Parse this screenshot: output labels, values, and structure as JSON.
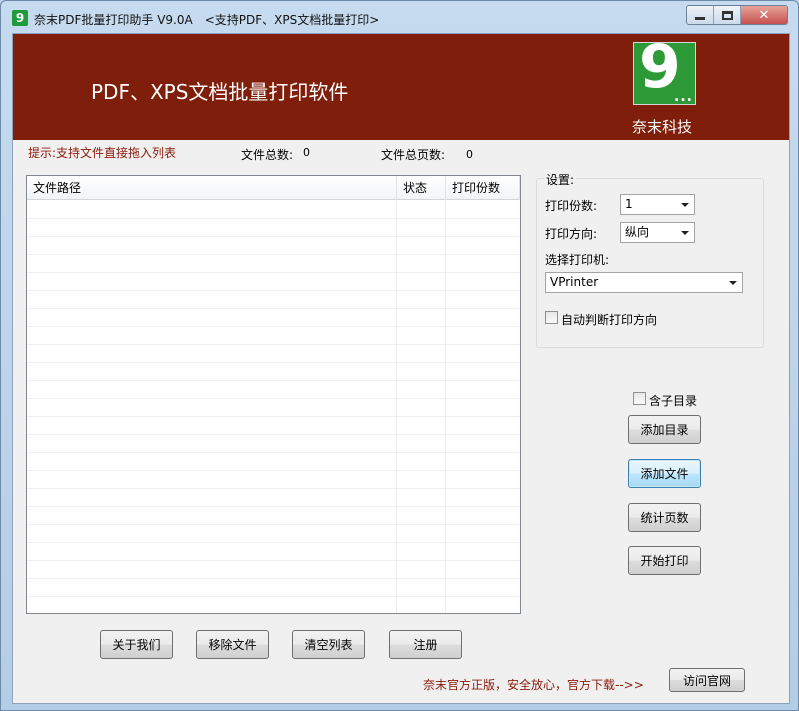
{
  "window": {
    "title": "奈末PDF批量打印助手 V9.0A　<支持PDF、XPS文档批量打印>",
    "app_icon_glyph": "9"
  },
  "banner": {
    "title": "PDF、XPS文档批量打印软件",
    "logo_digit": "9",
    "logo_dots": "...",
    "company": "奈末科技",
    "background_color": "#7f1f0b",
    "logo_color": "#2e9a37"
  },
  "hint": "提示:支持文件直接拖入列表",
  "stats": {
    "total_files_label": "文件总数:",
    "total_files_value": "0",
    "total_pages_label": "文件总页数:",
    "total_pages_value": "0"
  },
  "file_list": {
    "columns": [
      "文件路径",
      "状态",
      "打印份数"
    ],
    "rows": []
  },
  "settings": {
    "title": "设置:",
    "copies_label": "打印份数:",
    "copies_value": "1",
    "orientation_label": "打印方向:",
    "orientation_value": "纵向",
    "printer_label": "选择打印机:",
    "printer_value": "VPrinter",
    "auto_orientation_label": "自动判断打印方向",
    "auto_orientation_checked": false
  },
  "actions": {
    "include_subdir_label": "含子目录",
    "include_subdir_checked": false,
    "add_dir": "添加目录",
    "add_file": "添加文件",
    "count_pages": "统计页数",
    "start_print": "开始打印"
  },
  "bottom_buttons": {
    "about": "关于我们",
    "remove_file": "移除文件",
    "clear_list": "清空列表",
    "register": "注册"
  },
  "footer": {
    "notice": "奈末官方正版，安全放心，官方下载-->>",
    "visit_site": "访问官网",
    "accent_color": "#8a1b0b"
  }
}
